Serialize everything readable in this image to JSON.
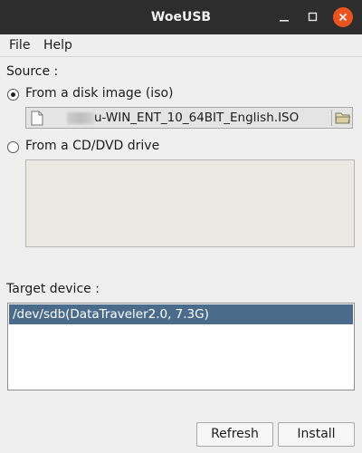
{
  "window": {
    "title": "WoeUSB"
  },
  "menu": {
    "file": "File",
    "help": "Help"
  },
  "source": {
    "label": "Source :",
    "option_iso": "From a disk image (iso)",
    "option_iso_selected": true,
    "iso_filename": "u-WIN_ENT_10_64BIT_English.ISO",
    "option_cd": "From a CD/DVD drive",
    "option_cd_selected": false
  },
  "target": {
    "label": "Target device :",
    "devices": [
      "/dev/sdb(DataTraveler2.0,  7.3G)"
    ],
    "selected_index": 0
  },
  "buttons": {
    "refresh": "Refresh",
    "install": "Install"
  },
  "colors": {
    "titlebar": "#2d2d2d",
    "close_button": "#e9541f",
    "selection": "#4a6b8a"
  }
}
